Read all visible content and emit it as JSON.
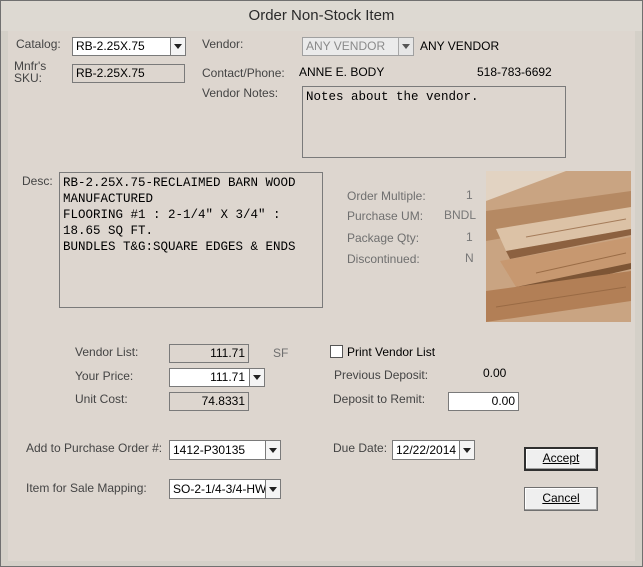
{
  "window": {
    "title": "Order Non-Stock Item"
  },
  "catalog": {
    "label": "Catalog:",
    "value": "RB-2.25X.75"
  },
  "mnfr_sku": {
    "label_line1": "Mnfr's",
    "label_line2": "SKU:",
    "value": "RB-2.25X.75"
  },
  "vendor": {
    "label": "Vendor:",
    "combo_value": "ANY VENDOR",
    "name": "ANY VENDOR"
  },
  "contact": {
    "label": "Contact/Phone:",
    "name": "ANNE E. BODY",
    "phone": "518-783-6692"
  },
  "vendor_notes": {
    "label": "Vendor Notes:",
    "text": "Notes about the vendor."
  },
  "desc": {
    "label": "Desc:",
    "text": "RB-2.25X.75-RECLAIMED BARN WOOD\nMANUFACTURED\nFLOORING #1 : 2-1/4\" X 3/4\" :\n18.65 SQ FT.\nBUNDLES T&G:SQUARE EDGES & ENDS"
  },
  "info": {
    "order_multiple": {
      "label": "Order Multiple:",
      "value": "1"
    },
    "purchase_um": {
      "label": "Purchase UM:",
      "value": "BNDL"
    },
    "package_qty": {
      "label": "Package Qty:",
      "value": "1"
    },
    "discontinued": {
      "label": "Discontinued:",
      "value": "N"
    }
  },
  "product_image": {
    "icon": "wood-planks-photo"
  },
  "pricing": {
    "vendor_list": {
      "label": "Vendor List:",
      "value": "111.71",
      "unit": "SF"
    },
    "your_price": {
      "label": "Your Price:",
      "value": "111.71"
    },
    "unit_cost": {
      "label": "Unit Cost:",
      "value": "74.8331"
    }
  },
  "print_vendor_list": {
    "label": "Print Vendor List",
    "checked": false
  },
  "deposit": {
    "previous": {
      "label": "Previous Deposit:",
      "value": "0.00"
    },
    "remit": {
      "label": "Deposit to Remit:",
      "value": "0.00"
    }
  },
  "purchase_order": {
    "label": "Add to Purchase Order #:",
    "value": "1412-P30135"
  },
  "due_date": {
    "label": "Due Date:",
    "value": "12/22/2014"
  },
  "sale_mapping": {
    "label": "Item for Sale Mapping:",
    "value": "SO-2-1/4-3/4-HW"
  },
  "buttons": {
    "accept": "Accept",
    "cancel": "Cancel"
  }
}
